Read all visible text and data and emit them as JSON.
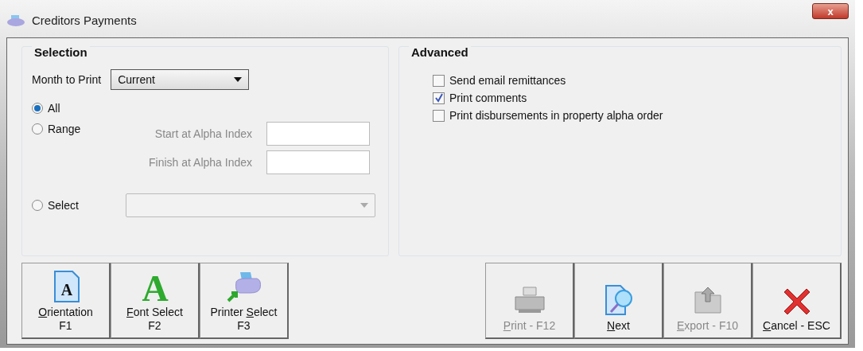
{
  "window": {
    "title": "Creditors Payments",
    "close": "x"
  },
  "selection": {
    "title": "Selection",
    "month_label": "Month to Print",
    "month_value": "Current",
    "radios": [
      {
        "kind": "plain",
        "label": "All",
        "selected": true
      },
      {
        "kind": "range",
        "label": "Range",
        "selected": false,
        "fields": [
          {
            "label": "Start at Alpha Index",
            "disabled": true
          },
          {
            "label": "Finish at Alpha Index",
            "disabled": true
          }
        ]
      },
      {
        "kind": "dropdown",
        "label": "Select",
        "selected": false,
        "disabled": true
      }
    ]
  },
  "advanced": {
    "title": "Advanced",
    "options": [
      {
        "label": "Send email remittances",
        "checked": false
      },
      {
        "label": "Print comments",
        "checked": true
      },
      {
        "label": "Print disbursements in property alpha order",
        "checked": false
      }
    ]
  },
  "left_buttons": [
    {
      "kind": "orientation",
      "icon_text": "A",
      "key": "O",
      "post": "rientation",
      "line2": "F1",
      "disabled": false
    },
    {
      "kind": "font",
      "icon_text": "A",
      "key": "F",
      "post": "ont Select",
      "line2": "F2",
      "disabled": false
    },
    {
      "kind": "printer",
      "pre": "Printer ",
      "key": "S",
      "post": "elect",
      "line2": "F3",
      "disabled": false
    }
  ],
  "right_buttons": [
    {
      "kind": "print",
      "key": "P",
      "post": "rint - F12",
      "disabled": true
    },
    {
      "kind": "next",
      "key": "N",
      "post": "ext",
      "disabled": false
    },
    {
      "kind": "export",
      "key": "E",
      "post": "xport - F10",
      "disabled": true
    },
    {
      "kind": "cancel",
      "key": "C",
      "post": "ancel - ESC",
      "disabled": false
    }
  ]
}
